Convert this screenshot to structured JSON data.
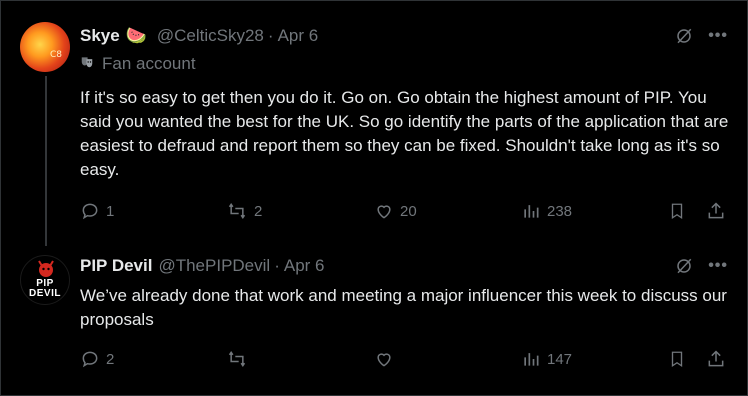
{
  "colors": {
    "background": "#000000",
    "text": "#e7e9ea",
    "muted": "#71767b",
    "border": "#2f3336"
  },
  "tweets": [
    {
      "name": "Skye",
      "name_emoji": "🍉",
      "handle": "@CelticSky28",
      "separator": "·",
      "date": "Apr 6",
      "label": "Fan account",
      "label_icon": "masks-icon",
      "avatar_mark": "C8",
      "text": "If it's so easy to get then you do it. Go on. Go obtain the highest amount of PIP. You said you wanted the best for the UK. So go identify the parts of the application that are easiest to defraud and report them so they can be fixed. Shouldn't take long as it's so easy.",
      "replies": "1",
      "reposts": "2",
      "likes": "20",
      "views": "238"
    },
    {
      "name": "PIP Devil",
      "handle": "@ThePIPDevil",
      "separator": "·",
      "date": "Apr 6",
      "avatar_line1": "PIP",
      "avatar_line2": "DEVIL",
      "text": "We’ve already done that work and meeting a major influencer this week to discuss our proposals",
      "replies": "2",
      "reposts": "",
      "likes": "",
      "views": "147"
    }
  ],
  "more_label": "•••"
}
